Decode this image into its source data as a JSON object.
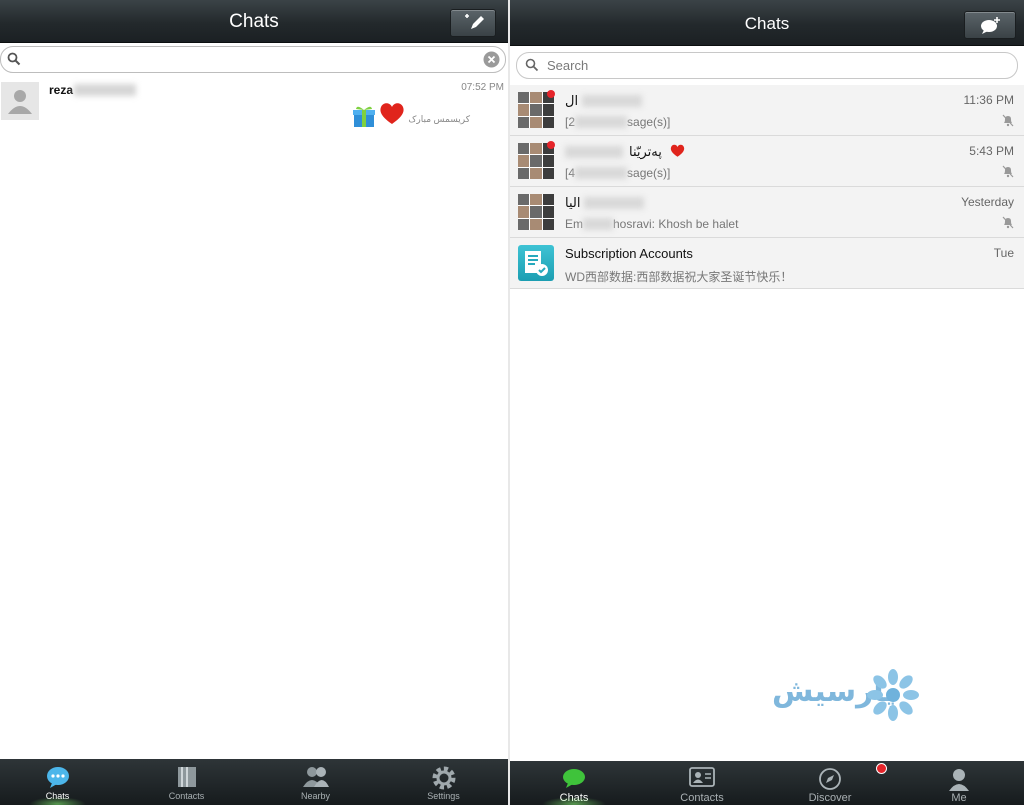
{
  "left": {
    "header": {
      "title": "Chats"
    },
    "chat": {
      "name": "reza",
      "time": "07:52 PM",
      "message": "کریسمس مبارک"
    },
    "tabs": [
      {
        "label": "Chats",
        "icon": "chat-bubble-icon"
      },
      {
        "label": "Contacts",
        "icon": "contacts-book-icon"
      },
      {
        "label": "Nearby",
        "icon": "people-icon"
      },
      {
        "label": "Settings",
        "icon": "gear-icon"
      }
    ]
  },
  "right": {
    "header": {
      "title": "Chats"
    },
    "search": {
      "placeholder": "Search"
    },
    "chats": [
      {
        "name": "ال",
        "preview_prefix": "[2",
        "preview_suffix": "sage(s)]",
        "time": "11:36 PM"
      },
      {
        "name": "پەتریّنا",
        "preview_prefix": "[4",
        "preview_suffix": "sage(s)]",
        "time": "5:43 PM"
      },
      {
        "name": "الیا",
        "preview_prefix": "Em",
        "preview_suffix": "hosravi: Khosh be halet",
        "time": "Yesterday"
      },
      {
        "name": "Subscription Accounts",
        "preview": "WD西部数据:西部数据祝大家圣诞节快乐！",
        "time": "Tue"
      }
    ],
    "tabs": [
      {
        "label": "Chats",
        "icon": "chat-bubble-icon"
      },
      {
        "label": "Contacts",
        "icon": "contact-card-icon"
      },
      {
        "label": "Discover",
        "icon": "compass-icon"
      },
      {
        "label": "Me",
        "icon": "person-icon"
      }
    ]
  },
  "watermark": {
    "text": "پارسیش"
  }
}
